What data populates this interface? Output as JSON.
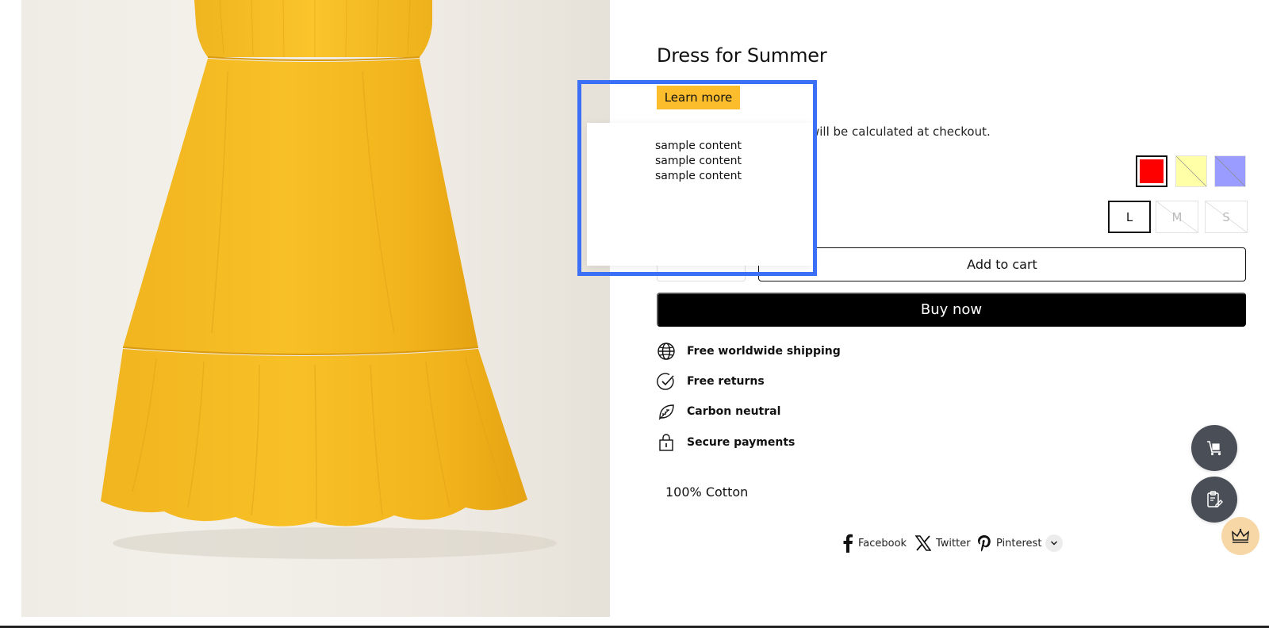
{
  "product": {
    "title": "Dress for Summer",
    "learn_more_label": "Learn more",
    "tax_note": "will be calculated at checkout.",
    "image_alt_icon": "product-photo-yellow-dress",
    "colors": [
      {
        "name": "red",
        "hex": "#ff0000",
        "selected": true,
        "available": true
      },
      {
        "name": "yellow",
        "hex": "#ffffa8",
        "selected": false,
        "available": false
      },
      {
        "name": "blue",
        "hex": "#9a9cff",
        "selected": false,
        "available": false
      }
    ],
    "sizes": [
      {
        "label": "L",
        "selected": true,
        "available": true
      },
      {
        "label": "M",
        "selected": false,
        "available": false
      },
      {
        "label": "S",
        "selected": false,
        "available": false
      }
    ],
    "add_to_cart_label": "Add to cart",
    "buy_now_label": "Buy now",
    "features": [
      {
        "icon": "globe-icon",
        "label": "Free worldwide shipping"
      },
      {
        "icon": "check-circle-icon",
        "label": "Free returns"
      },
      {
        "icon": "leaf-icon",
        "label": "Carbon neutral"
      },
      {
        "icon": "lock-icon",
        "label": "Secure payments"
      }
    ],
    "material": "100% Cotton"
  },
  "popover": {
    "lines": [
      "sample content",
      "sample content",
      "sample content"
    ]
  },
  "share": {
    "facebook_label": "Facebook",
    "twitter_label": "Twitter",
    "pinterest_label": "Pinterest"
  },
  "colors": {
    "accent_yellow": "#fbbd2c",
    "highlight_blue": "#3b6ff5",
    "fab_gray": "#4a4f57",
    "fab_peach": "#f7d7a6"
  }
}
